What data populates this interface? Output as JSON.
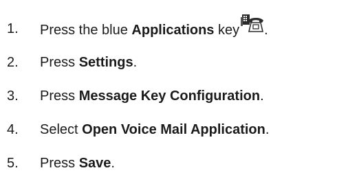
{
  "steps": [
    {
      "number": "1.",
      "prefix": "Press the blue ",
      "bold": "Applications",
      "suffix": " key",
      "end": ".",
      "icon": "applications-key-icon"
    },
    {
      "number": "2.",
      "prefix": "Press ",
      "bold": "Settings",
      "suffix": ".",
      "icon": ""
    },
    {
      "number": "3.",
      "prefix": "Press ",
      "bold": "Message Key Configuration",
      "suffix": ".",
      "icon": ""
    },
    {
      "number": "4.",
      "prefix": "Select ",
      "bold": "Open Voice Mail Application",
      "suffix": ".",
      "icon": ""
    },
    {
      "number": "5.",
      "prefix": "Press ",
      "bold": "Save",
      "suffix": ".",
      "icon": ""
    }
  ]
}
